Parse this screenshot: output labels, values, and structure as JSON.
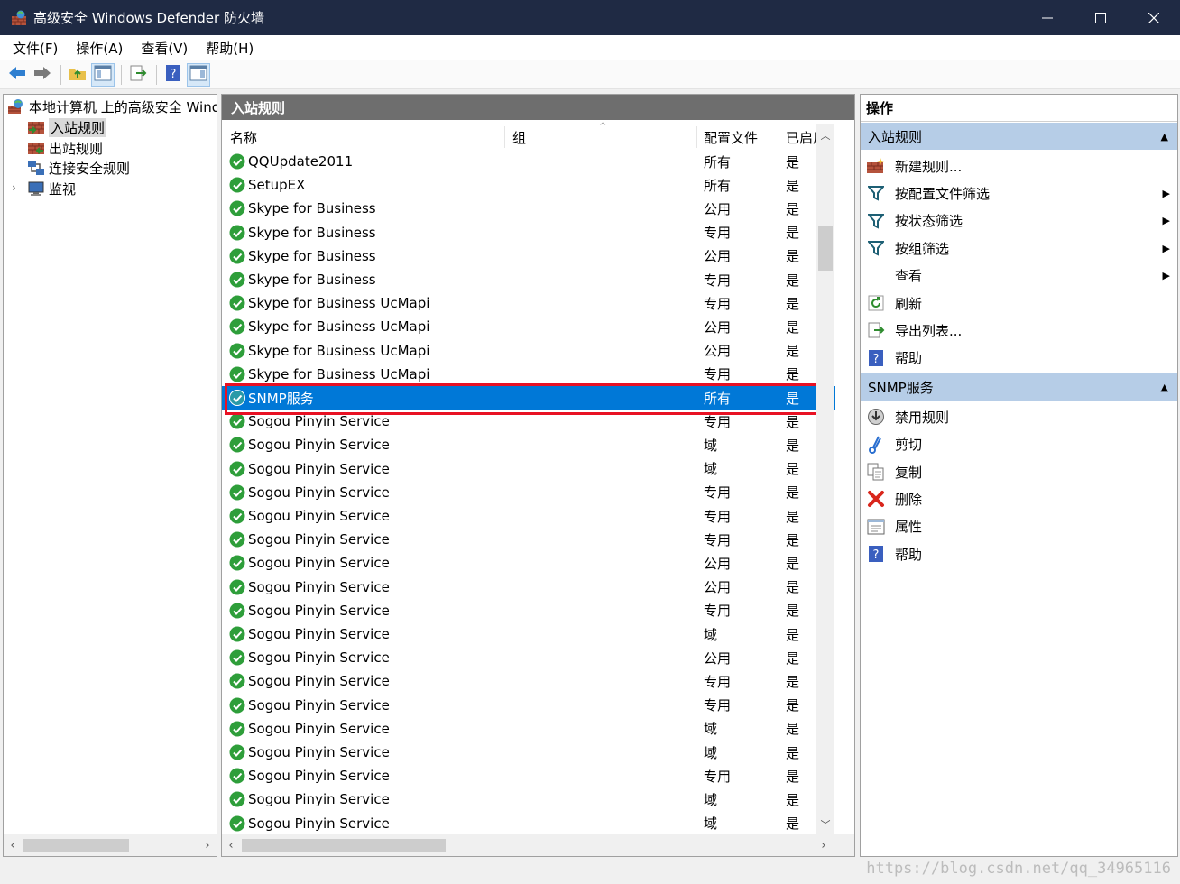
{
  "window": {
    "title": "高级安全 Windows Defender 防火墙",
    "minimize": "─",
    "maximize": "☐",
    "close": "✕"
  },
  "menu": [
    "文件(F)",
    "操作(A)",
    "查看(V)",
    "帮助(H)"
  ],
  "tree": {
    "root": "本地计算机 上的高级安全 Windows Defender 防火墙",
    "items": [
      {
        "label": "入站规则",
        "selected": true
      },
      {
        "label": "出站规则",
        "selected": false
      },
      {
        "label": "连接安全规则",
        "selected": false
      },
      {
        "label": "监视",
        "selected": false,
        "expander": "›"
      }
    ]
  },
  "center": {
    "title": "入站规则",
    "columns": {
      "name": "名称",
      "group": "组",
      "profile": "配置文件",
      "enabled": "已启用"
    },
    "rows": [
      {
        "name": "QQUpdate2011",
        "profile": "所有",
        "enabled": "是"
      },
      {
        "name": "SetupEX",
        "profile": "所有",
        "enabled": "是"
      },
      {
        "name": "Skype for Business",
        "profile": "公用",
        "enabled": "是"
      },
      {
        "name": "Skype for Business",
        "profile": "专用",
        "enabled": "是"
      },
      {
        "name": "Skype for Business",
        "profile": "公用",
        "enabled": "是"
      },
      {
        "name": "Skype for Business",
        "profile": "专用",
        "enabled": "是"
      },
      {
        "name": "Skype for Business UcMapi",
        "profile": "专用",
        "enabled": "是"
      },
      {
        "name": "Skype for Business UcMapi",
        "profile": "公用",
        "enabled": "是"
      },
      {
        "name": "Skype for Business UcMapi",
        "profile": "公用",
        "enabled": "是"
      },
      {
        "name": "Skype for Business UcMapi",
        "profile": "专用",
        "enabled": "是"
      },
      {
        "name": "SNMP服务",
        "profile": "所有",
        "enabled": "是",
        "selected": true
      },
      {
        "name": "Sogou Pinyin Service",
        "profile": "专用",
        "enabled": "是"
      },
      {
        "name": "Sogou Pinyin Service",
        "profile": "域",
        "enabled": "是"
      },
      {
        "name": "Sogou Pinyin Service",
        "profile": "域",
        "enabled": "是"
      },
      {
        "name": "Sogou Pinyin Service",
        "profile": "专用",
        "enabled": "是"
      },
      {
        "name": "Sogou Pinyin Service",
        "profile": "专用",
        "enabled": "是"
      },
      {
        "name": "Sogou Pinyin Service",
        "profile": "专用",
        "enabled": "是"
      },
      {
        "name": "Sogou Pinyin Service",
        "profile": "公用",
        "enabled": "是"
      },
      {
        "name": "Sogou Pinyin Service",
        "profile": "公用",
        "enabled": "是"
      },
      {
        "name": "Sogou Pinyin Service",
        "profile": "专用",
        "enabled": "是"
      },
      {
        "name": "Sogou Pinyin Service",
        "profile": "域",
        "enabled": "是"
      },
      {
        "name": "Sogou Pinyin Service",
        "profile": "公用",
        "enabled": "是"
      },
      {
        "name": "Sogou Pinyin Service",
        "profile": "专用",
        "enabled": "是"
      },
      {
        "name": "Sogou Pinyin Service",
        "profile": "专用",
        "enabled": "是"
      },
      {
        "name": "Sogou Pinyin Service",
        "profile": "域",
        "enabled": "是"
      },
      {
        "name": "Sogou Pinyin Service",
        "profile": "域",
        "enabled": "是"
      },
      {
        "name": "Sogou Pinyin Service",
        "profile": "专用",
        "enabled": "是"
      },
      {
        "name": "Sogou Pinyin Service",
        "profile": "域",
        "enabled": "是"
      },
      {
        "name": "Sogou Pinyin Service",
        "profile": "域",
        "enabled": "是"
      }
    ]
  },
  "actions": {
    "title": "操作",
    "sections": [
      {
        "title": "入站规则",
        "items": [
          {
            "label": "新建规则...",
            "icon": "new-rule-icon",
            "submenu": false
          },
          {
            "label": "按配置文件筛选",
            "icon": "filter-icon",
            "submenu": true
          },
          {
            "label": "按状态筛选",
            "icon": "filter-icon",
            "submenu": true
          },
          {
            "label": "按组筛选",
            "icon": "filter-icon",
            "submenu": true
          },
          {
            "label": "查看",
            "icon": "none",
            "submenu": true
          },
          {
            "label": "刷新",
            "icon": "refresh-icon",
            "submenu": false
          },
          {
            "label": "导出列表...",
            "icon": "export-icon",
            "submenu": false
          },
          {
            "label": "帮助",
            "icon": "help-icon",
            "submenu": false
          }
        ]
      },
      {
        "title": "SNMP服务",
        "items": [
          {
            "label": "禁用规则",
            "icon": "disable-icon",
            "submenu": false
          },
          {
            "label": "剪切",
            "icon": "cut-icon",
            "submenu": false
          },
          {
            "label": "复制",
            "icon": "copy-icon",
            "submenu": false
          },
          {
            "label": "删除",
            "icon": "delete-icon",
            "submenu": false
          },
          {
            "label": "属性",
            "icon": "properties-icon",
            "submenu": false
          },
          {
            "label": "帮助",
            "icon": "help-icon",
            "submenu": false
          }
        ]
      }
    ]
  },
  "watermark": "https://blog.csdn.net/qq_34965116",
  "colors": {
    "accent": "#0078d7",
    "highlight_border": "#e81123",
    "section_bg": "#b6cde7",
    "title_bar": "#1f2a44"
  }
}
